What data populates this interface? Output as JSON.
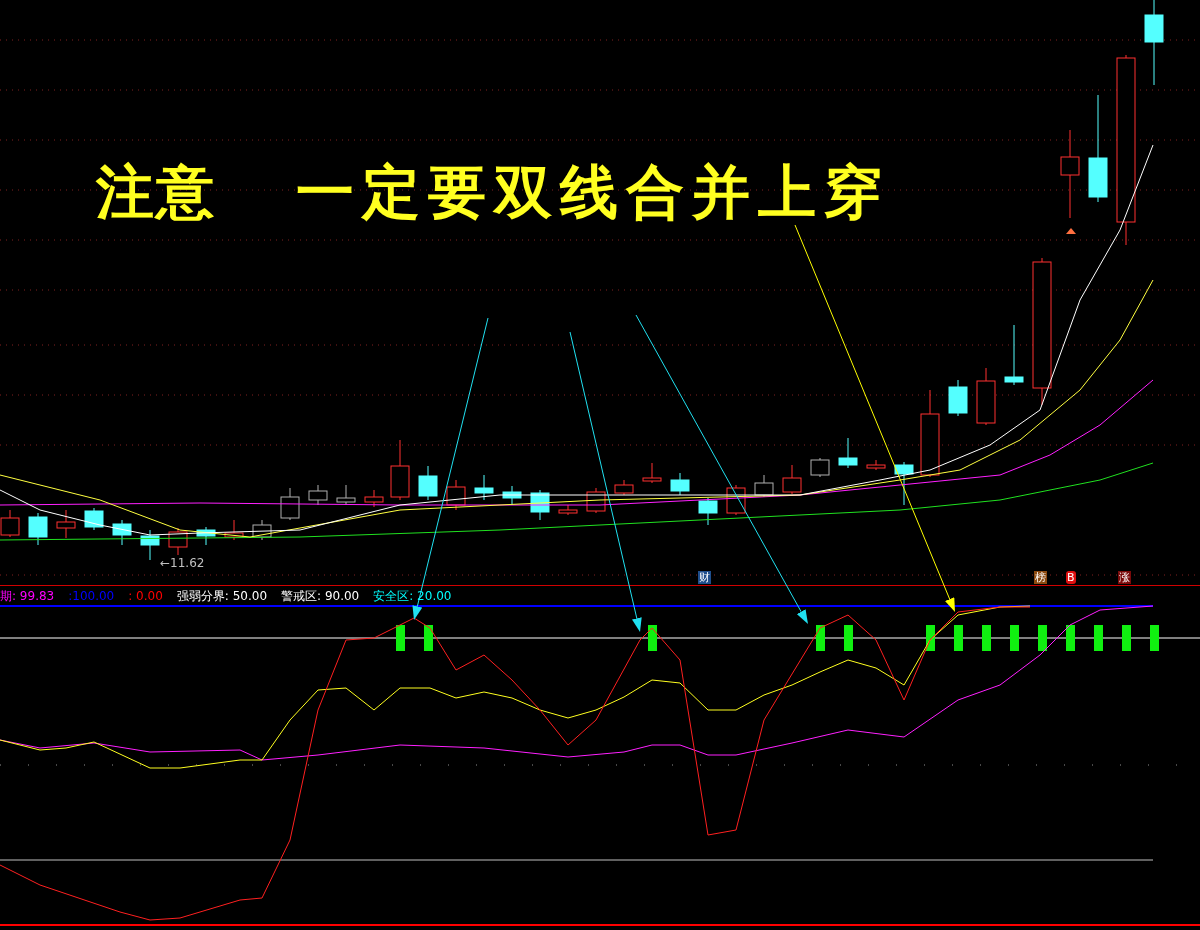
{
  "annotation": {
    "title_left": "注意",
    "title_right": "一定要双线合并上穿"
  },
  "price_chart": {
    "low_label": "←11.62",
    "markers": [
      {
        "text": "财",
        "color": "#1f4e8c"
      },
      {
        "text": "榜",
        "color": "#8b4a10"
      },
      {
        "text": "B",
        "color": "#dd1010"
      },
      {
        "text": "涨",
        "color": "#7a0a0a"
      }
    ]
  },
  "indicator": {
    "legend": [
      {
        "text": "期: 99.83",
        "color": "#ff00ff"
      },
      {
        "text": ":100.00",
        "color": "#0000ff"
      },
      {
        "text": ": 0.00",
        "color": "#ff0000"
      },
      {
        "text": "强弱分界: 50.00",
        "color": "#ffffff"
      },
      {
        "text": "警戒区: 90.00",
        "color": "#ffffff"
      },
      {
        "text": "安全区: 20.00",
        "color": "#00ffff"
      }
    ]
  }
}
